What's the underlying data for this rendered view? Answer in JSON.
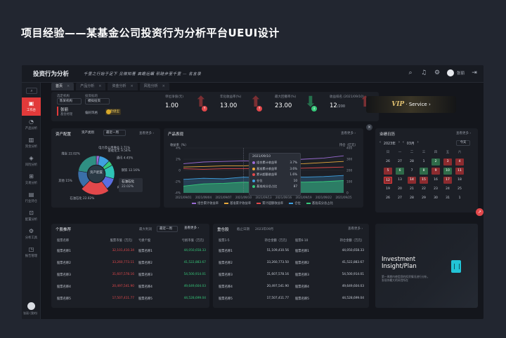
{
  "slide_title": "项目经验——某基金公司投资行为分析平台UEUI设计",
  "app": {
    "title": "投资行为分析",
    "slogan": "千里之行始于足下 见微知著 高瞻远瞩 积跬步至千里 — 名言录",
    "username": "张丽"
  },
  "sidebar": {
    "search_icon": "⌕",
    "items": [
      {
        "icon": "▣",
        "label": "工作台"
      },
      {
        "icon": "◔",
        "label": "产品分析"
      },
      {
        "icon": "▥",
        "label": "资金分析"
      },
      {
        "icon": "◈",
        "label": "风险分析"
      },
      {
        "icon": "⊞",
        "label": "交易分析"
      },
      {
        "icon": "▤",
        "label": "行业持仓"
      },
      {
        "icon": "⊡",
        "label": "配置分析"
      },
      {
        "icon": "⚙",
        "label": "分析工具"
      },
      {
        "icon": "◳",
        "label": "报告管理"
      }
    ],
    "bottom_label": "张丽 (我的)"
  },
  "tabs": [
    {
      "label": "首页"
    },
    {
      "label": "产品分析"
    },
    {
      "label": "资金分析"
    },
    {
      "label": "风险分析"
    }
  ],
  "filters": {
    "account_label": "选定机构",
    "account_value": "陈某机构",
    "product_label": "投资标的",
    "product_value": "模拟投资",
    "account_name": "张丽",
    "account_sub": "基金经理",
    "risk_label": "偏好风格",
    "risk_value": "稳健型"
  },
  "kpis": [
    {
      "label": "单位净值(元)",
      "value": "1.00",
      "suffix": "",
      "arrow": "up",
      "color": "#e2484b"
    },
    {
      "label": "年化收益率(%)",
      "value": "13.00",
      "suffix": "",
      "arrow": "up",
      "color": "#e2484b"
    },
    {
      "label": "最大回撤率(%)",
      "value": "23.00",
      "suffix": "",
      "arrow": "down",
      "color": "#36c97a"
    },
    {
      "label": "收益排名 (2021/09/10)",
      "value": "12",
      "suffix": "/200",
      "arrow": "up",
      "color": "#e2484b"
    }
  ],
  "vip": {
    "brand": "VIP",
    "text": " · Service ›"
  },
  "asset_panel": {
    "title": "资产配置",
    "tab1": "资产类别",
    "period": "最近一周",
    "more": "查看更多 ›",
    "center_label": "资产配置",
    "callout_name": "石油石化",
    "callout_value": "22.02%"
  },
  "chart_data": [
    {
      "type": "pie",
      "title": "资产配置",
      "slices": [
        {
          "label": "电力及公用事业",
          "value": 2.71,
          "color": "#9b6bd4"
        },
        {
          "label": "基础化工",
          "value": 9.54,
          "color": "#3fa0e0"
        },
        {
          "label": "通讯",
          "value": 4.45,
          "color": "#36c97a"
        },
        {
          "label": "钢铁",
          "value": 12.16,
          "color": "#2ec4b6"
        },
        {
          "label": "有色金属",
          "value": 10.47,
          "color": "#5b6ee1"
        },
        {
          "label": "石油石化",
          "value": 22.02,
          "color": "#e2484b"
        },
        {
          "label": "其他",
          "value": 15.0,
          "color": "#3a6fa8"
        },
        {
          "label": "煤炭",
          "value": 22.02,
          "color": "#2f8f83"
        }
      ]
    },
    {
      "type": "line",
      "title": "产品表现",
      "more": "查看更多 ›",
      "ylabel_left": "收益率（%）",
      "ylabel_right": "持仓（亿元）",
      "y_ticks": [
        "4%",
        "2%",
        "0",
        "-2%",
        "-4%"
      ],
      "y2_ticks": [
        "400",
        "300",
        "200",
        "100",
        "0"
      ],
      "x": [
        "2021/09/01",
        "2021/09/04",
        "2021/09/07",
        "2021/09/10",
        "2021/09/13",
        "2021/09/16",
        "2021/09/19",
        "2021/09/22",
        "2021/09/25"
      ],
      "tooltip": {
        "date": "2021/09/10",
        "rows": [
          {
            "name": "组合累计收益率",
            "value": "3.7%",
            "color": "#9b6bd4"
          },
          {
            "name": "基准累计收益率",
            "value": "3.6%",
            "color": "#e8a93b"
          },
          {
            "name": "累计超额收益率",
            "value": "1.6%",
            "color": "#e2484b"
          },
          {
            "name": "仓位",
            "value": "10",
            "color": "#3fa0e0"
          },
          {
            "name": "基准成分总占比",
            "value": "87",
            "color": "#36c97a"
          }
        ]
      },
      "series": [
        {
          "name": "组合累计收益率",
          "color": "#9b6bd4",
          "values": [
            1.2,
            1.5,
            1.6,
            1.7,
            1.6,
            1.8,
            2.0,
            2.2,
            2.6
          ]
        },
        {
          "name": "基准累计收益率",
          "color": "#e8a93b",
          "values": [
            0.6,
            0.7,
            0.8,
            0.8,
            1.0,
            1.1,
            1.2,
            1.4,
            1.6
          ]
        },
        {
          "name": "累计超额收益率",
          "color": "#e2484b",
          "values": [
            0.3,
            0.2,
            0.3,
            0.3,
            0.4,
            0.3,
            0.4,
            0.5,
            0.6
          ]
        },
        {
          "name": "仓位",
          "color": "#3fa0e0",
          "values": [
            -1.6,
            -1.4,
            -1.5,
            -1.2,
            -1.3,
            -1.0,
            -1.2,
            -1.1,
            -0.9
          ]
        },
        {
          "name": "基准成分总占比",
          "color": "#36c97a",
          "values": [
            -2.8,
            -2.4,
            -2.3,
            -2.1,
            -2.2,
            -2.0,
            -2.1,
            -2.0,
            -1.8
          ]
        }
      ],
      "ylim": [
        -4,
        4
      ]
    }
  ],
  "calendar": {
    "title": "业绩日历",
    "more": "查看更多 ›",
    "year": "2023年",
    "month": "03月",
    "today": "今天",
    "weekdays": [
      "日",
      "一",
      "二",
      "三",
      "四",
      "五",
      "六"
    ],
    "weeks": [
      [
        {
          "d": "26",
          "s": ""
        },
        {
          "d": "27",
          "s": ""
        },
        {
          "d": "28",
          "s": ""
        },
        {
          "d": "1",
          "s": ""
        },
        {
          "d": "2",
          "s": "green"
        },
        {
          "d": "3",
          "s": "red"
        },
        {
          "d": "4",
          "s": "red"
        }
      ],
      [
        {
          "d": "5",
          "s": "red"
        },
        {
          "d": "6",
          "s": "green"
        },
        {
          "d": "7",
          "s": ""
        },
        {
          "d": "8",
          "s": "green"
        },
        {
          "d": "9",
          "s": "red"
        },
        {
          "d": "10",
          "s": "green"
        },
        {
          "d": "11",
          "s": "red"
        }
      ],
      [
        {
          "d": "12",
          "s": "red sel"
        },
        {
          "d": "13",
          "s": ""
        },
        {
          "d": "14",
          "s": "red"
        },
        {
          "d": "15",
          "s": "red"
        },
        {
          "d": "16",
          "s": ""
        },
        {
          "d": "17",
          "s": "red"
        },
        {
          "d": "18",
          "s": ""
        }
      ],
      [
        {
          "d": "19",
          "s": ""
        },
        {
          "d": "20",
          "s": ""
        },
        {
          "d": "21",
          "s": ""
        },
        {
          "d": "22",
          "s": ""
        },
        {
          "d": "23",
          "s": ""
        },
        {
          "d": "24",
          "s": ""
        },
        {
          "d": "25",
          "s": ""
        }
      ],
      [
        {
          "d": "26",
          "s": ""
        },
        {
          "d": "27",
          "s": ""
        },
        {
          "d": "28",
          "s": ""
        },
        {
          "d": "29",
          "s": ""
        },
        {
          "d": "30",
          "s": ""
        },
        {
          "d": "31",
          "s": ""
        },
        {
          "d": "1",
          "s": ""
        }
      ]
    ]
  },
  "stock_panel": {
    "title": "个股推荐",
    "sort_label": "最大利润",
    "period": "最近一周",
    "more": "查看更多 ›",
    "headers_left": [
      "股票名称",
      "股票市值（万元）"
    ],
    "headers_right": [
      "亏损个股",
      "亏损市值（万元）"
    ],
    "rows": [
      {
        "name": "股票名称1",
        "value": "32,101,410.34",
        "loss_name": "股票名称1",
        "loss_value": "44,050,658.33"
      },
      {
        "name": "股票名称2",
        "value": "33,260,773.11",
        "loss_name": "股票名称2",
        "loss_value": "41,522,883.67"
      },
      {
        "name": "股票名称3",
        "value": "31,607,578.16",
        "loss_name": "股票名称3",
        "loss_value": "54,500,914.01"
      },
      {
        "name": "股票名称4",
        "value": "20,497,541.90",
        "loss_name": "股票名称4",
        "loss_value": "49,649,604.03"
      },
      {
        "name": "股票名称5",
        "value": "17,507,411.77",
        "loss_name": "股票名称5",
        "loss_value": "44,528,699.04"
      }
    ]
  },
  "holding_panel": {
    "title": "重仓股",
    "sub1": "截止日期",
    "date": "2023年09月",
    "more": "查看更多 ›",
    "headers_left": [
      "股票1-5",
      "持仓金额（万元）"
    ],
    "headers_right": [
      "股票6-10",
      "持仓金额（万元）"
    ],
    "rows": [
      {
        "a": "股票名称1",
        "av": "51,109,410.56",
        "b": "股票名称1",
        "bv": "44,050,658.33"
      },
      {
        "a": "股票名称2",
        "av": "33,260,773.50",
        "b": "股票名称2",
        "bv": "41,522,883.67"
      },
      {
        "a": "股票名称3",
        "av": "31,607,578.16",
        "b": "股票名称3",
        "bv": "54,500,914.01"
      },
      {
        "a": "股票名称4",
        "av": "20,497,541.90",
        "b": "股票名称4",
        "bv": "49,649,604.03"
      },
      {
        "a": "股票名称5",
        "av": "17,507,411.77",
        "b": "股票名称5",
        "bv": "44,528,699.04"
      }
    ]
  },
  "invest": {
    "title_line1": "Investment",
    "title_line2": "Insight/Plan",
    "sub": "第一周期内使用您的投资情况进行分析，发现你最大的风险所在"
  }
}
